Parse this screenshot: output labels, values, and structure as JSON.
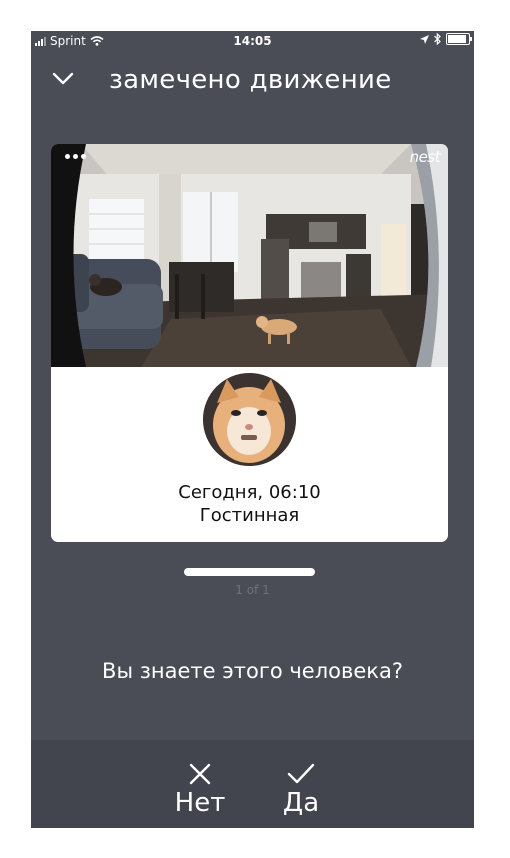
{
  "status_bar": {
    "carrier": "Sprint",
    "time": "14:05",
    "icons": [
      "signal-icon",
      "wifi-icon",
      "location-icon",
      "bluetooth-icon",
      "battery-icon"
    ]
  },
  "header": {
    "title": "замечено движение",
    "back_icon": "chevron-down-icon"
  },
  "event_card": {
    "brand": "nest",
    "menu_icon": "more-dots-icon",
    "time": "Сегодня, 06:10",
    "room": "Гостинная"
  },
  "pager": {
    "label": "1 of 1"
  },
  "question": "Вы знаете этого человека?",
  "actions": {
    "no_label": "Нет",
    "no_icon": "close-icon",
    "yes_label": "Да",
    "yes_icon": "checkmark-icon"
  },
  "colors": {
    "background": "#4a4c56",
    "bottom_bar": "#42444e",
    "card": "#ffffff",
    "text_light": "#ffffff",
    "pager_text": "#6f717b"
  }
}
